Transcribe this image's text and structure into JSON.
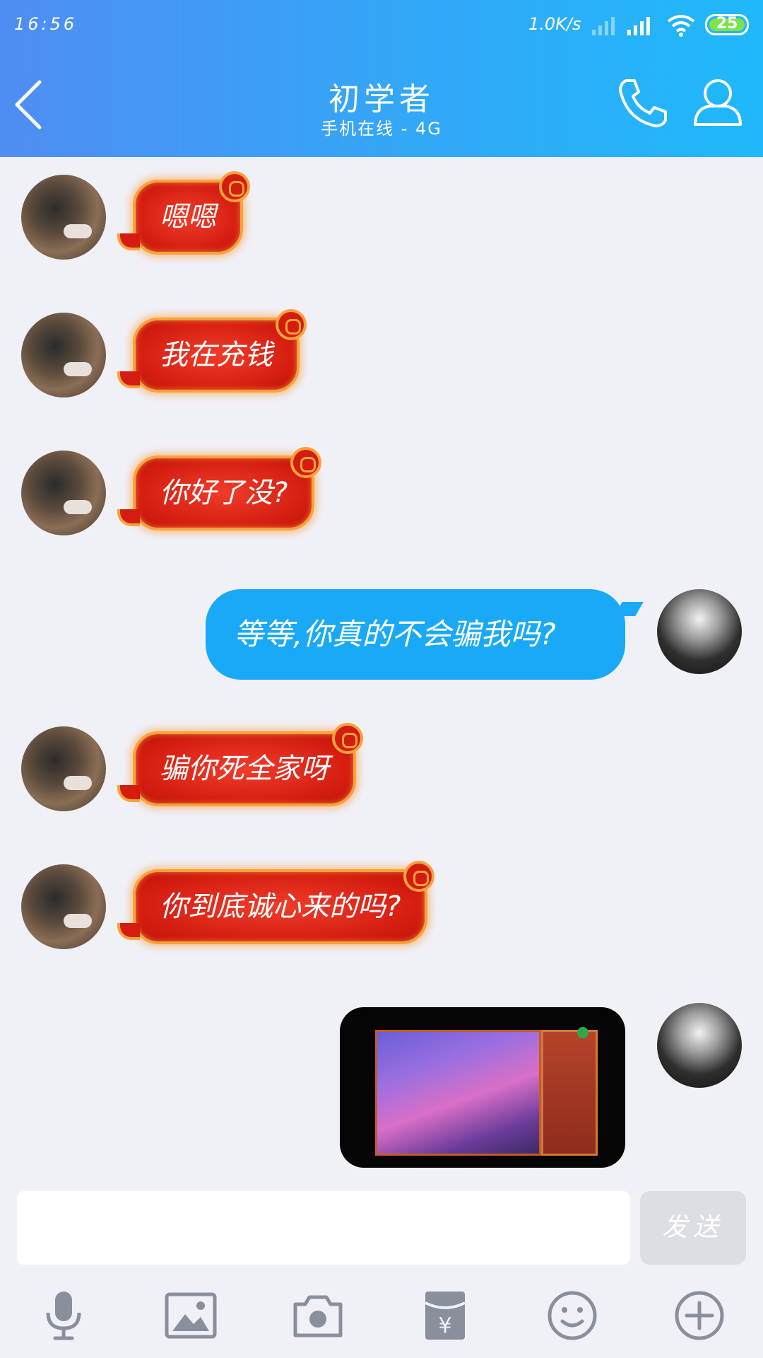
{
  "status_bar": {
    "time": "16:56",
    "net_speed": "1.0K/s",
    "battery": "25"
  },
  "header": {
    "contact_name": "初学者",
    "status": "手机在线 - 4G"
  },
  "messages": [
    {
      "from": "other",
      "text": "嗯嗯"
    },
    {
      "from": "other",
      "text": "我在充钱"
    },
    {
      "from": "other",
      "text": "你好了没?"
    },
    {
      "from": "me",
      "text": "等等,你真的不会骗我吗?"
    },
    {
      "from": "other",
      "text": "骗你死全家呀"
    },
    {
      "from": "other",
      "text": "你到底诚心来的吗?"
    },
    {
      "from": "me",
      "type": "image"
    }
  ],
  "composer": {
    "input_value": "",
    "send_label": "发送"
  },
  "toolbar": [
    "microphone-icon",
    "image-icon",
    "camera-icon",
    "red-packet-icon",
    "emoji-icon",
    "plus-icon"
  ],
  "colors": {
    "header_start": "#4f8df3",
    "header_end": "#1fb8fb",
    "bubble_blue": "#19a9f6",
    "bubble_red": "#d41d10"
  }
}
